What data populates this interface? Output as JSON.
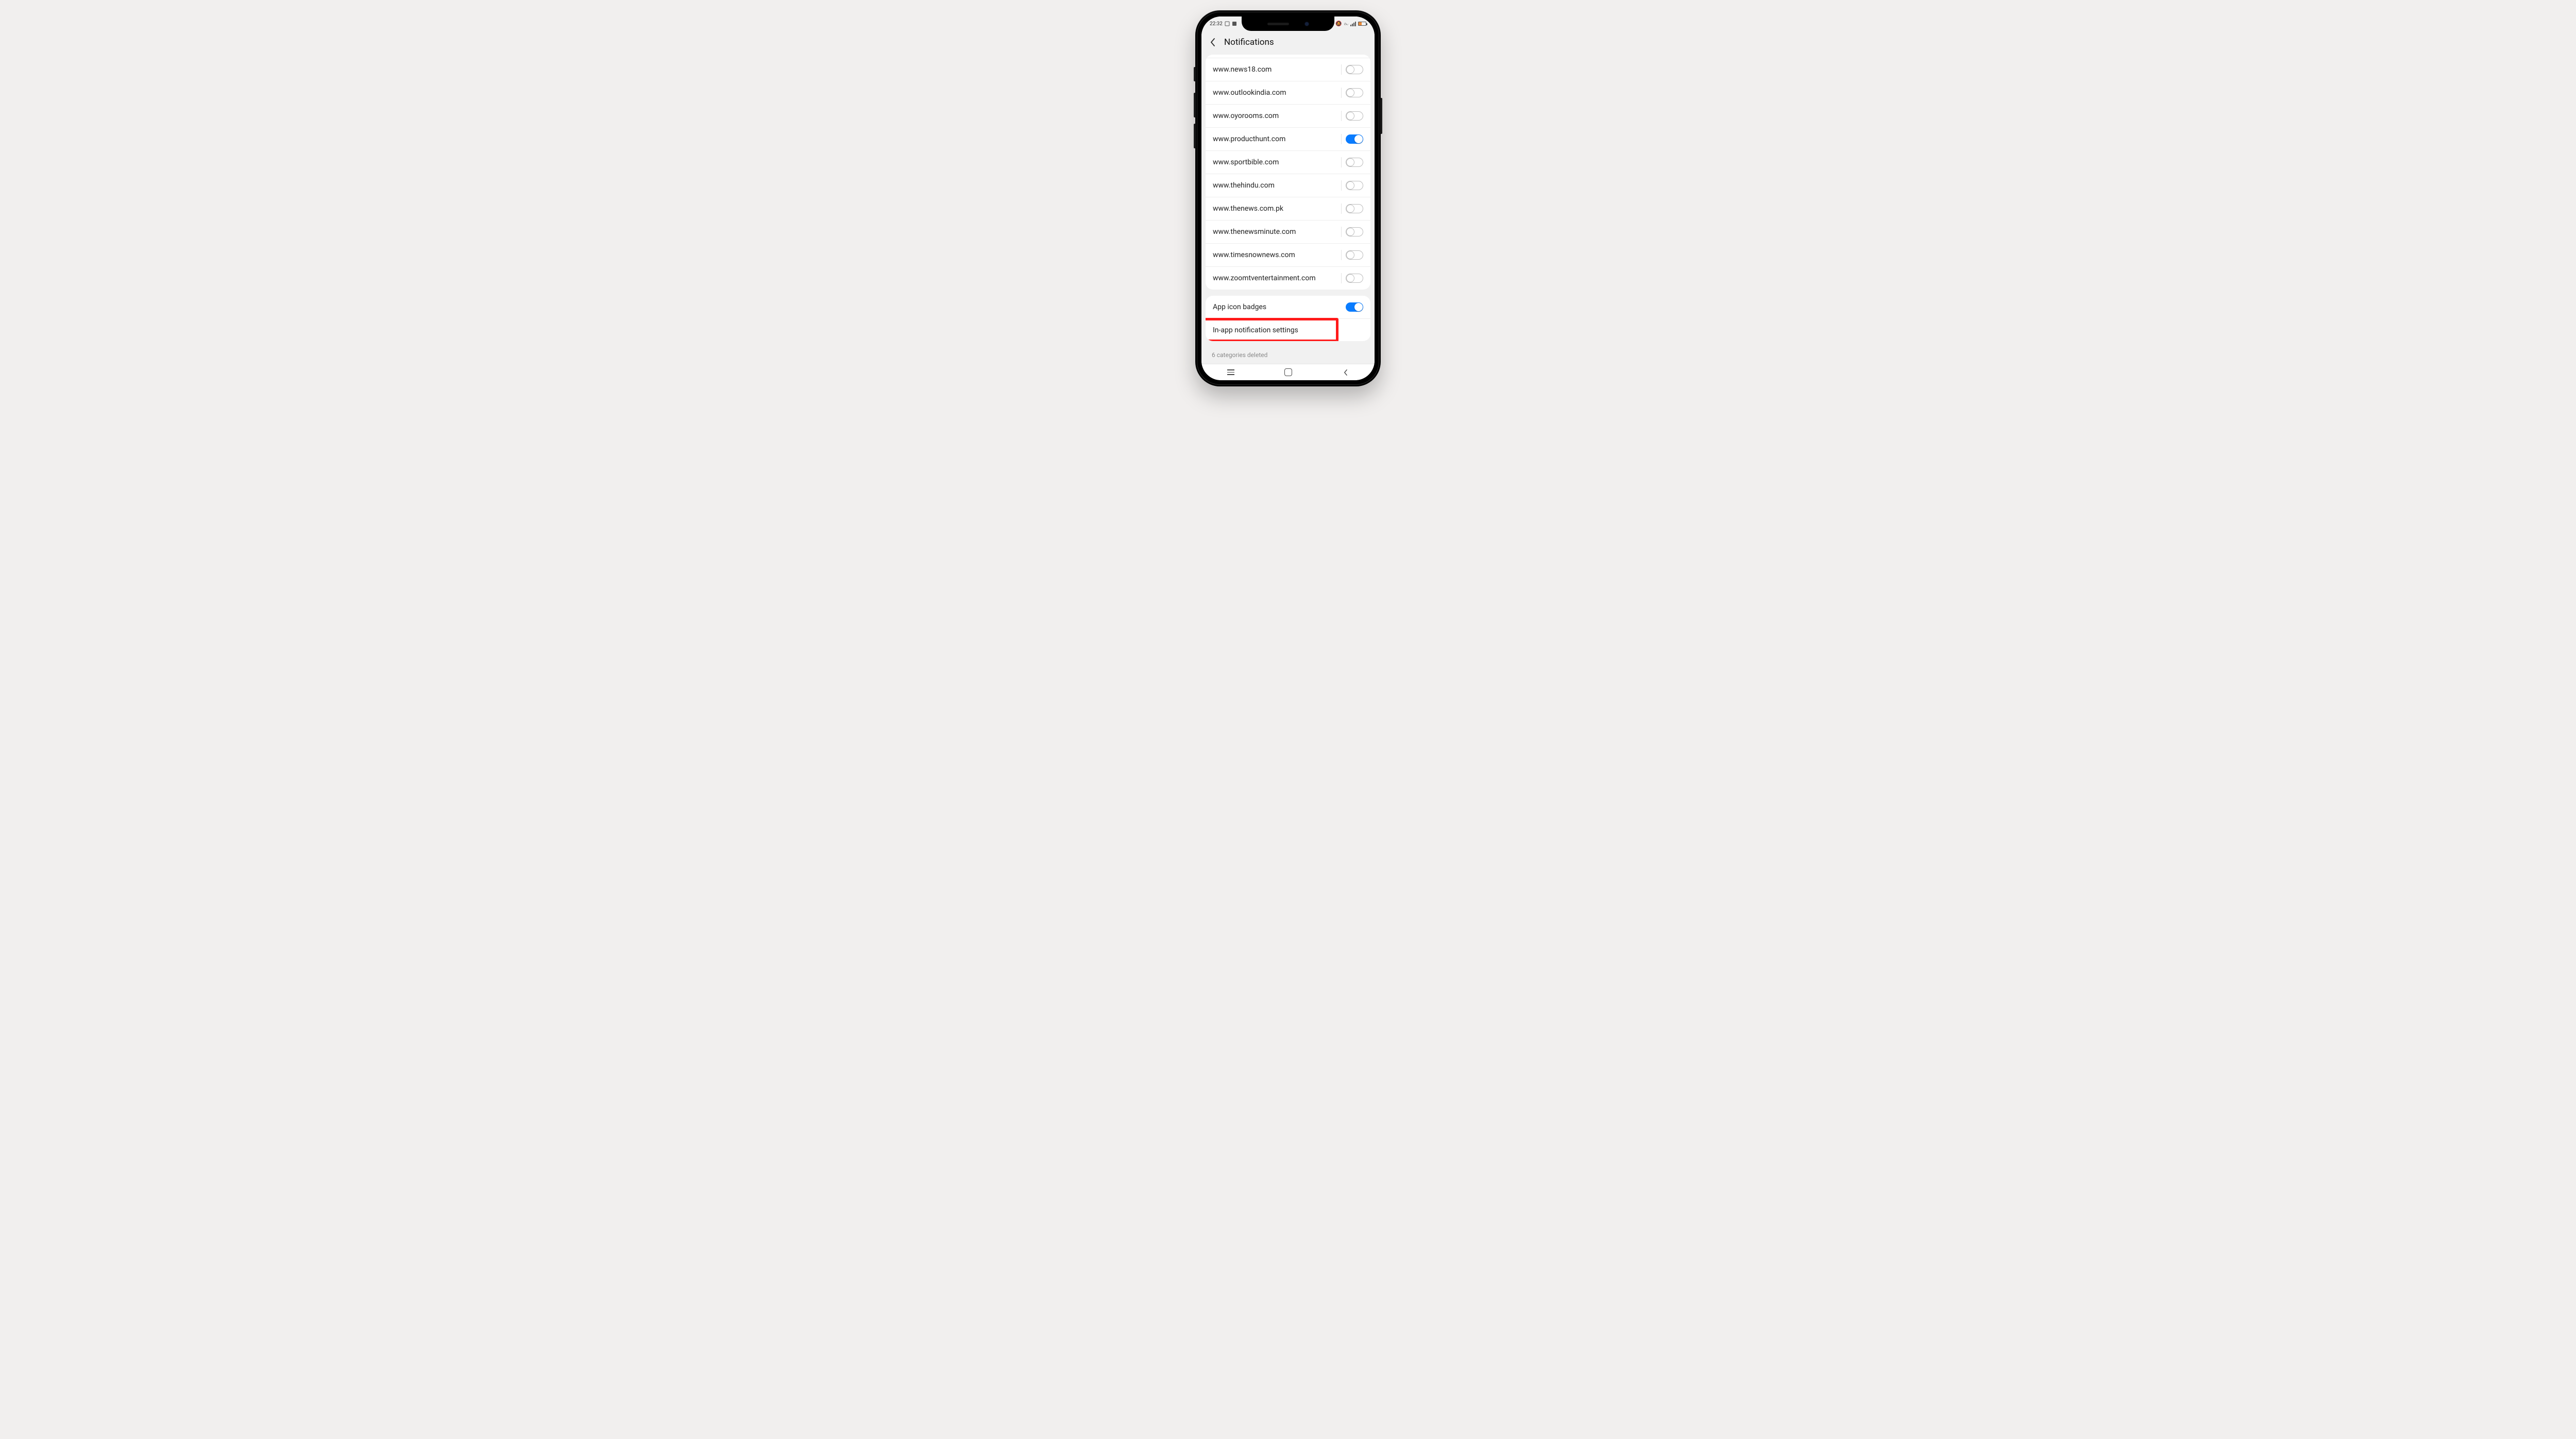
{
  "statusbar": {
    "time": "22:32"
  },
  "header": {
    "title": "Notifications"
  },
  "sites": [
    {
      "domain": "www.news18.com",
      "enabled": false
    },
    {
      "domain": "www.outlookindia.com",
      "enabled": false
    },
    {
      "domain": "www.oyorooms.com",
      "enabled": false
    },
    {
      "domain": "www.producthunt.com",
      "enabled": true
    },
    {
      "domain": "www.sportbible.com",
      "enabled": false
    },
    {
      "domain": "www.thehindu.com",
      "enabled": false
    },
    {
      "domain": "www.thenews.com.pk",
      "enabled": false
    },
    {
      "domain": "www.thenewsminute.com",
      "enabled": false
    },
    {
      "domain": "www.timesnownews.com",
      "enabled": false
    },
    {
      "domain": "www.zoomtventertainment.com",
      "enabled": false
    }
  ],
  "settings": {
    "app_icon_badges": {
      "label": "App icon badges",
      "enabled": true
    },
    "in_app": {
      "label": "In-app notification settings"
    }
  },
  "footer": {
    "deleted_note": "6 categories deleted"
  }
}
